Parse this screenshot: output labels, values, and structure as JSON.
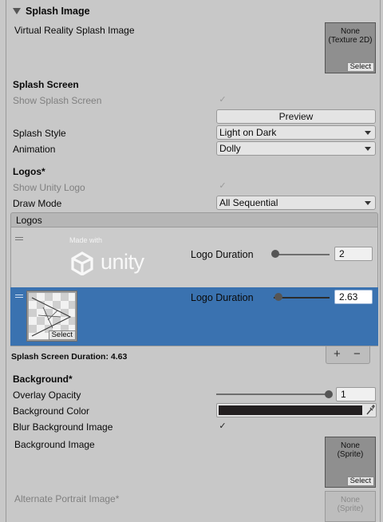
{
  "splash_image": {
    "title": "Splash Image",
    "vr_label": "Virtual Reality Splash Image",
    "vr_field_text": "None\n(Texture 2D)",
    "vr_select": "Select"
  },
  "splash_screen": {
    "title": "Splash Screen",
    "show_label": "Show Splash Screen",
    "show_checked": true,
    "preview_button": "Preview",
    "style_label": "Splash Style",
    "style_value": "Light on Dark",
    "animation_label": "Animation",
    "animation_value": "Dolly"
  },
  "logos": {
    "title": "Logos*",
    "show_unity_label": "Show Unity Logo",
    "show_unity_checked": true,
    "draw_mode_label": "Draw Mode",
    "draw_mode_value": "All Sequential",
    "list_header": "Logos",
    "items": [
      {
        "logo_text_small": "Made with",
        "logo_text_big": "unity",
        "duration_label": "Logo Duration",
        "duration_value": "2",
        "slider_fraction": 0.0,
        "selected": false
      },
      {
        "thumb_select": "Select",
        "duration_label": "Logo Duration",
        "duration_value": "2.63",
        "slider_fraction": 0.06,
        "selected": true
      }
    ],
    "total_duration": "Splash Screen Duration: 4.63",
    "add_button": "+",
    "remove_button": "−"
  },
  "background": {
    "title": "Background*",
    "overlay_label": "Overlay Opacity",
    "overlay_value": "1",
    "overlay_fraction": 1.0,
    "color_label": "Background Color",
    "color_hex": "#231f20",
    "blur_label": "Blur Background Image",
    "blur_checked": true,
    "image_label": "Background Image",
    "image_field_text": "None\n(Sprite)",
    "image_select": "Select",
    "portrait_label": "Alternate Portrait Image*",
    "portrait_field_text": "None\n(Sprite)"
  },
  "colors": {
    "panel_bg": "#c8c8c8",
    "selected_row": "#3a72b0",
    "field_bg": "#e4e4e4"
  }
}
